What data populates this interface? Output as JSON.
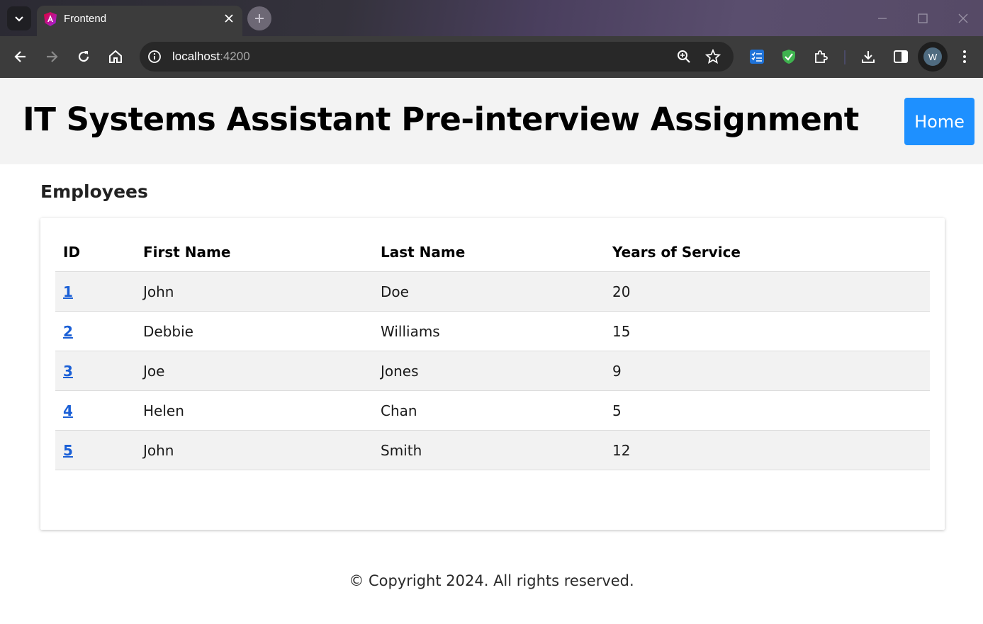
{
  "browser": {
    "tab_title": "Frontend",
    "url_host": "localhost",
    "url_port": ":4200",
    "profile_initial": "W"
  },
  "header": {
    "title": "IT Systems Assistant Pre-interview Assignment",
    "home_label": "Home",
    "home_color": "#1e90ff"
  },
  "main": {
    "section_title": "Employees",
    "columns": [
      "ID",
      "First Name",
      "Last Name",
      "Years of Service"
    ],
    "rows": [
      {
        "id": "1",
        "first": "John",
        "last": "Doe",
        "years": "20"
      },
      {
        "id": "2",
        "first": "Debbie",
        "last": "Williams",
        "years": "15"
      },
      {
        "id": "3",
        "first": "Joe",
        "last": "Jones",
        "years": "9"
      },
      {
        "id": "4",
        "first": "Helen",
        "last": "Chan",
        "years": "5"
      },
      {
        "id": "5",
        "first": "John",
        "last": "Smith",
        "years": "12"
      }
    ]
  },
  "footer": {
    "text": "© Copyright 2024. All rights reserved."
  }
}
